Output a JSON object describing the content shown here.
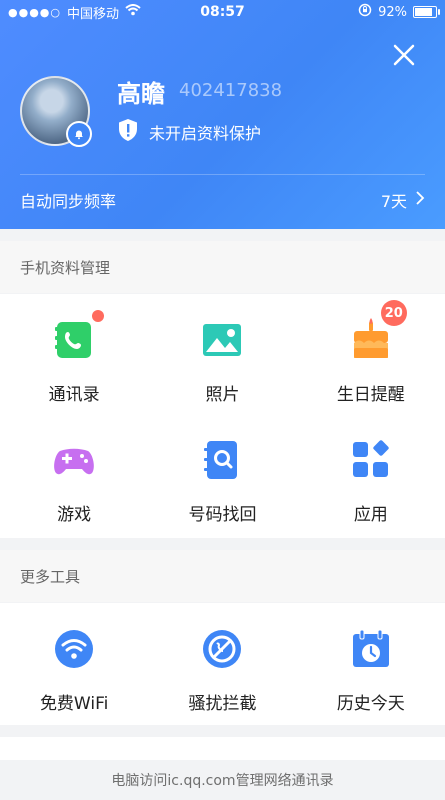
{
  "status_bar": {
    "carrier": "中国移动",
    "time": "08:57",
    "battery_text": "92%"
  },
  "profile": {
    "name": "高瞻",
    "qq_number": "402417838",
    "protection_status": "未开启资料保护"
  },
  "sync": {
    "label": "自动同步频率",
    "value": "7天"
  },
  "sections": {
    "phone_data": {
      "title": "手机资料管理",
      "items": [
        {
          "label": "通讯录",
          "icon": "contacts-icon",
          "badge": "dot"
        },
        {
          "label": "照片",
          "icon": "photos-icon"
        },
        {
          "label": "生日提醒",
          "icon": "birthday-cake-icon",
          "badge_count": "20"
        },
        {
          "label": "游戏",
          "icon": "game-controller-icon"
        },
        {
          "label": "号码找回",
          "icon": "number-recovery-icon"
        },
        {
          "label": "应用",
          "icon": "apps-icon"
        }
      ]
    },
    "more_tools": {
      "title": "更多工具",
      "items": [
        {
          "label": "免费WiFi",
          "icon": "wifi-icon"
        },
        {
          "label": "骚扰拦截",
          "icon": "block-icon"
        },
        {
          "label": "历史今天",
          "icon": "calendar-clock-icon"
        }
      ]
    }
  },
  "footer": {
    "text": "电脑访问ic.qq.com管理网络通讯录"
  },
  "colors": {
    "header_blue": "#3f86f6",
    "badge_red": "#ff6b5e",
    "contacts_green": "#2fcf69",
    "photos_teal": "#2cc9b6",
    "birthday_orange": "#ff9b2f",
    "game_purple": "#c76ff0",
    "blue_icons": "#3f86f6"
  }
}
